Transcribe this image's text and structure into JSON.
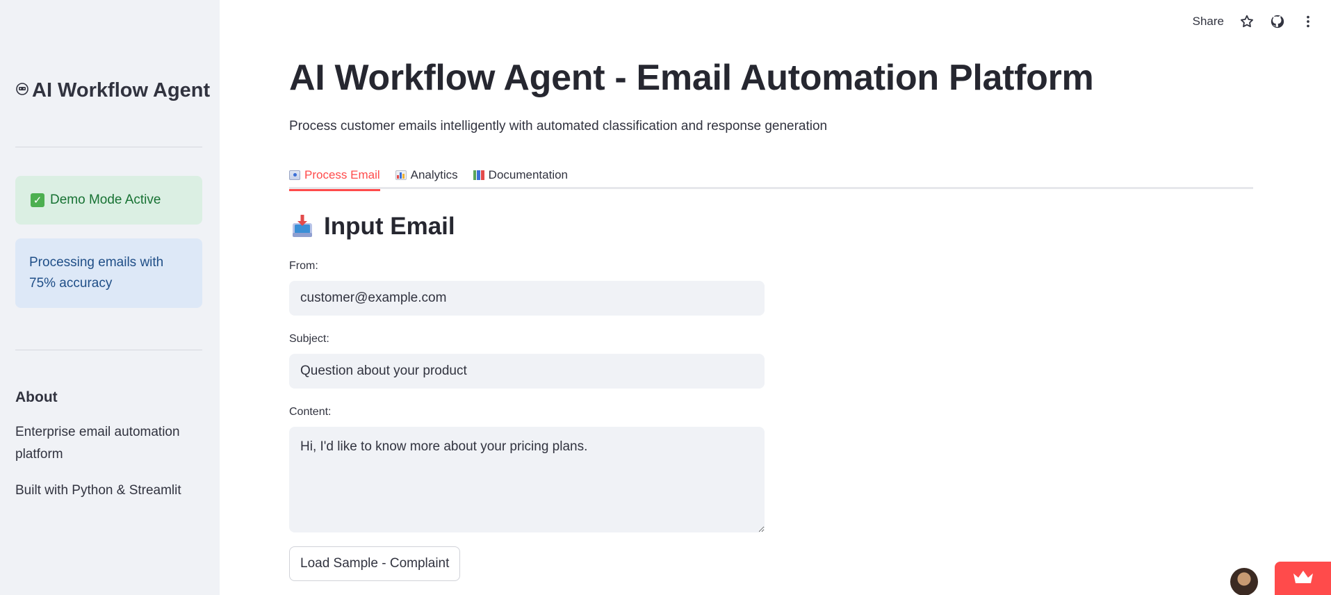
{
  "sidebar": {
    "title": "AI Workflow Agent",
    "title_icon": "robot-icon",
    "success_alert": "Demo Mode Active",
    "info_alert": "Processing emails with 75% accuracy",
    "about_heading": "About",
    "about_text": "Enterprise email automation platform",
    "built_with": "Built with Python & Streamlit"
  },
  "header": {
    "share_label": "Share",
    "icons": [
      "star-icon",
      "github-icon",
      "more-menu-icon"
    ]
  },
  "main": {
    "title": "AI Workflow Agent - Email Automation Platform",
    "subtitle": "Process customer emails intelligently with automated classification and response generation",
    "tabs": [
      {
        "label": "Process Email",
        "icon": "email-icon",
        "active": true
      },
      {
        "label": "Analytics",
        "icon": "bar-chart-icon",
        "active": false
      },
      {
        "label": "Documentation",
        "icon": "books-icon",
        "active": false
      }
    ],
    "section_title": "Input Email",
    "section_icon": "inbox-tray-icon",
    "form": {
      "from_label": "From:",
      "from_value": "customer@example.com",
      "subject_label": "Subject:",
      "subject_value": "Question about your product",
      "content_label": "Content:",
      "content_value": "Hi, I'd like to know more about your pricing plans."
    },
    "sample_button": "Load Sample - Complaint"
  },
  "colors": {
    "accent": "#ff4b4b",
    "sidebar_bg": "#f0f2f6",
    "success_bg": "#dbefe3",
    "info_bg": "#dde8f7"
  }
}
